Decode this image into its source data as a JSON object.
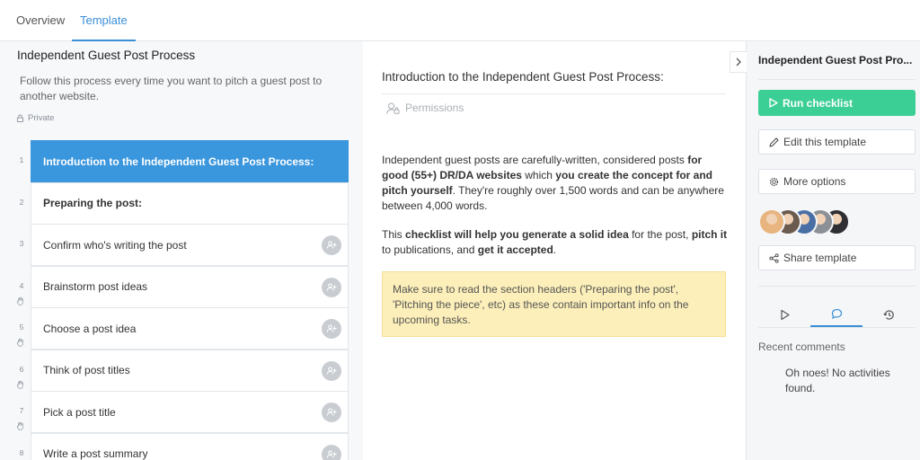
{
  "tabs": [
    {
      "label": "Overview",
      "active": false
    },
    {
      "label": "Template",
      "active": true
    }
  ],
  "template": {
    "title": "Independent Guest Post Process",
    "description": "Follow this process every time you want to pitch a guest post to another website.",
    "privacy": "Private"
  },
  "tasks": [
    {
      "num": "1",
      "label": "Introduction to the Independent Guest Post Process:",
      "type": "heading",
      "active": true
    },
    {
      "num": "2",
      "label": "Preparing the post:",
      "type": "heading"
    },
    {
      "num": "3",
      "label": "Confirm who's writing the post",
      "type": "task"
    },
    {
      "num": "4",
      "label": "Brainstorm post ideas",
      "type": "task",
      "stop": true
    },
    {
      "num": "5",
      "label": "Choose a post idea",
      "type": "task",
      "stop": true
    },
    {
      "num": "6",
      "label": "Think of post titles",
      "type": "task",
      "stop": true
    },
    {
      "num": "7",
      "label": "Pick a post title",
      "type": "task",
      "stop": true
    },
    {
      "num": "8",
      "label": "Write a post summary",
      "type": "task"
    }
  ],
  "step": {
    "title": "Introduction to the Independent Guest Post Process:",
    "permissions_label": "Permissions",
    "para1": [
      {
        "t": "Independent guest posts are carefully-written, considered posts ",
        "b": false
      },
      {
        "t": "for good (55+) DR/DA websites",
        "b": true
      },
      {
        "t": " which ",
        "b": false
      },
      {
        "t": "you create the concept for and pitch yourself",
        "b": true
      },
      {
        "t": ". They're roughly over 1,500 words and can be anywhere between 4,000 words.",
        "b": false
      }
    ],
    "para2": [
      {
        "t": "This ",
        "b": false
      },
      {
        "t": "checklist will help you generate a solid idea",
        "b": true
      },
      {
        "t": " for the post, ",
        "b": false
      },
      {
        "t": "pitch it",
        "b": true
      },
      {
        "t": " to publications, and ",
        "b": false
      },
      {
        "t": "get it accepted",
        "b": true
      },
      {
        "t": ".",
        "b": false
      }
    ],
    "callout": "Make sure to read the section headers ('Preparing the post', 'Pitching the piece', etc) as these contain important info on the upcoming tasks."
  },
  "sidebar": {
    "title": "Independent Guest Post Pro...",
    "run_label": "Run checklist",
    "edit_label": "Edit this template",
    "more_label": "More options",
    "share_label": "Share template",
    "avatars": [
      "#e8b57f",
      "#6b5a4e",
      "#4a6fa5",
      "#8b8f96",
      "#2f2f33"
    ],
    "recent_label": "Recent comments",
    "no_activity": "Oh noes! No activities found."
  },
  "colors": {
    "accent": "#3a8fd8",
    "run": "#3ccf95",
    "callout": "#fcefb9",
    "active_task": "#3a96dd"
  }
}
